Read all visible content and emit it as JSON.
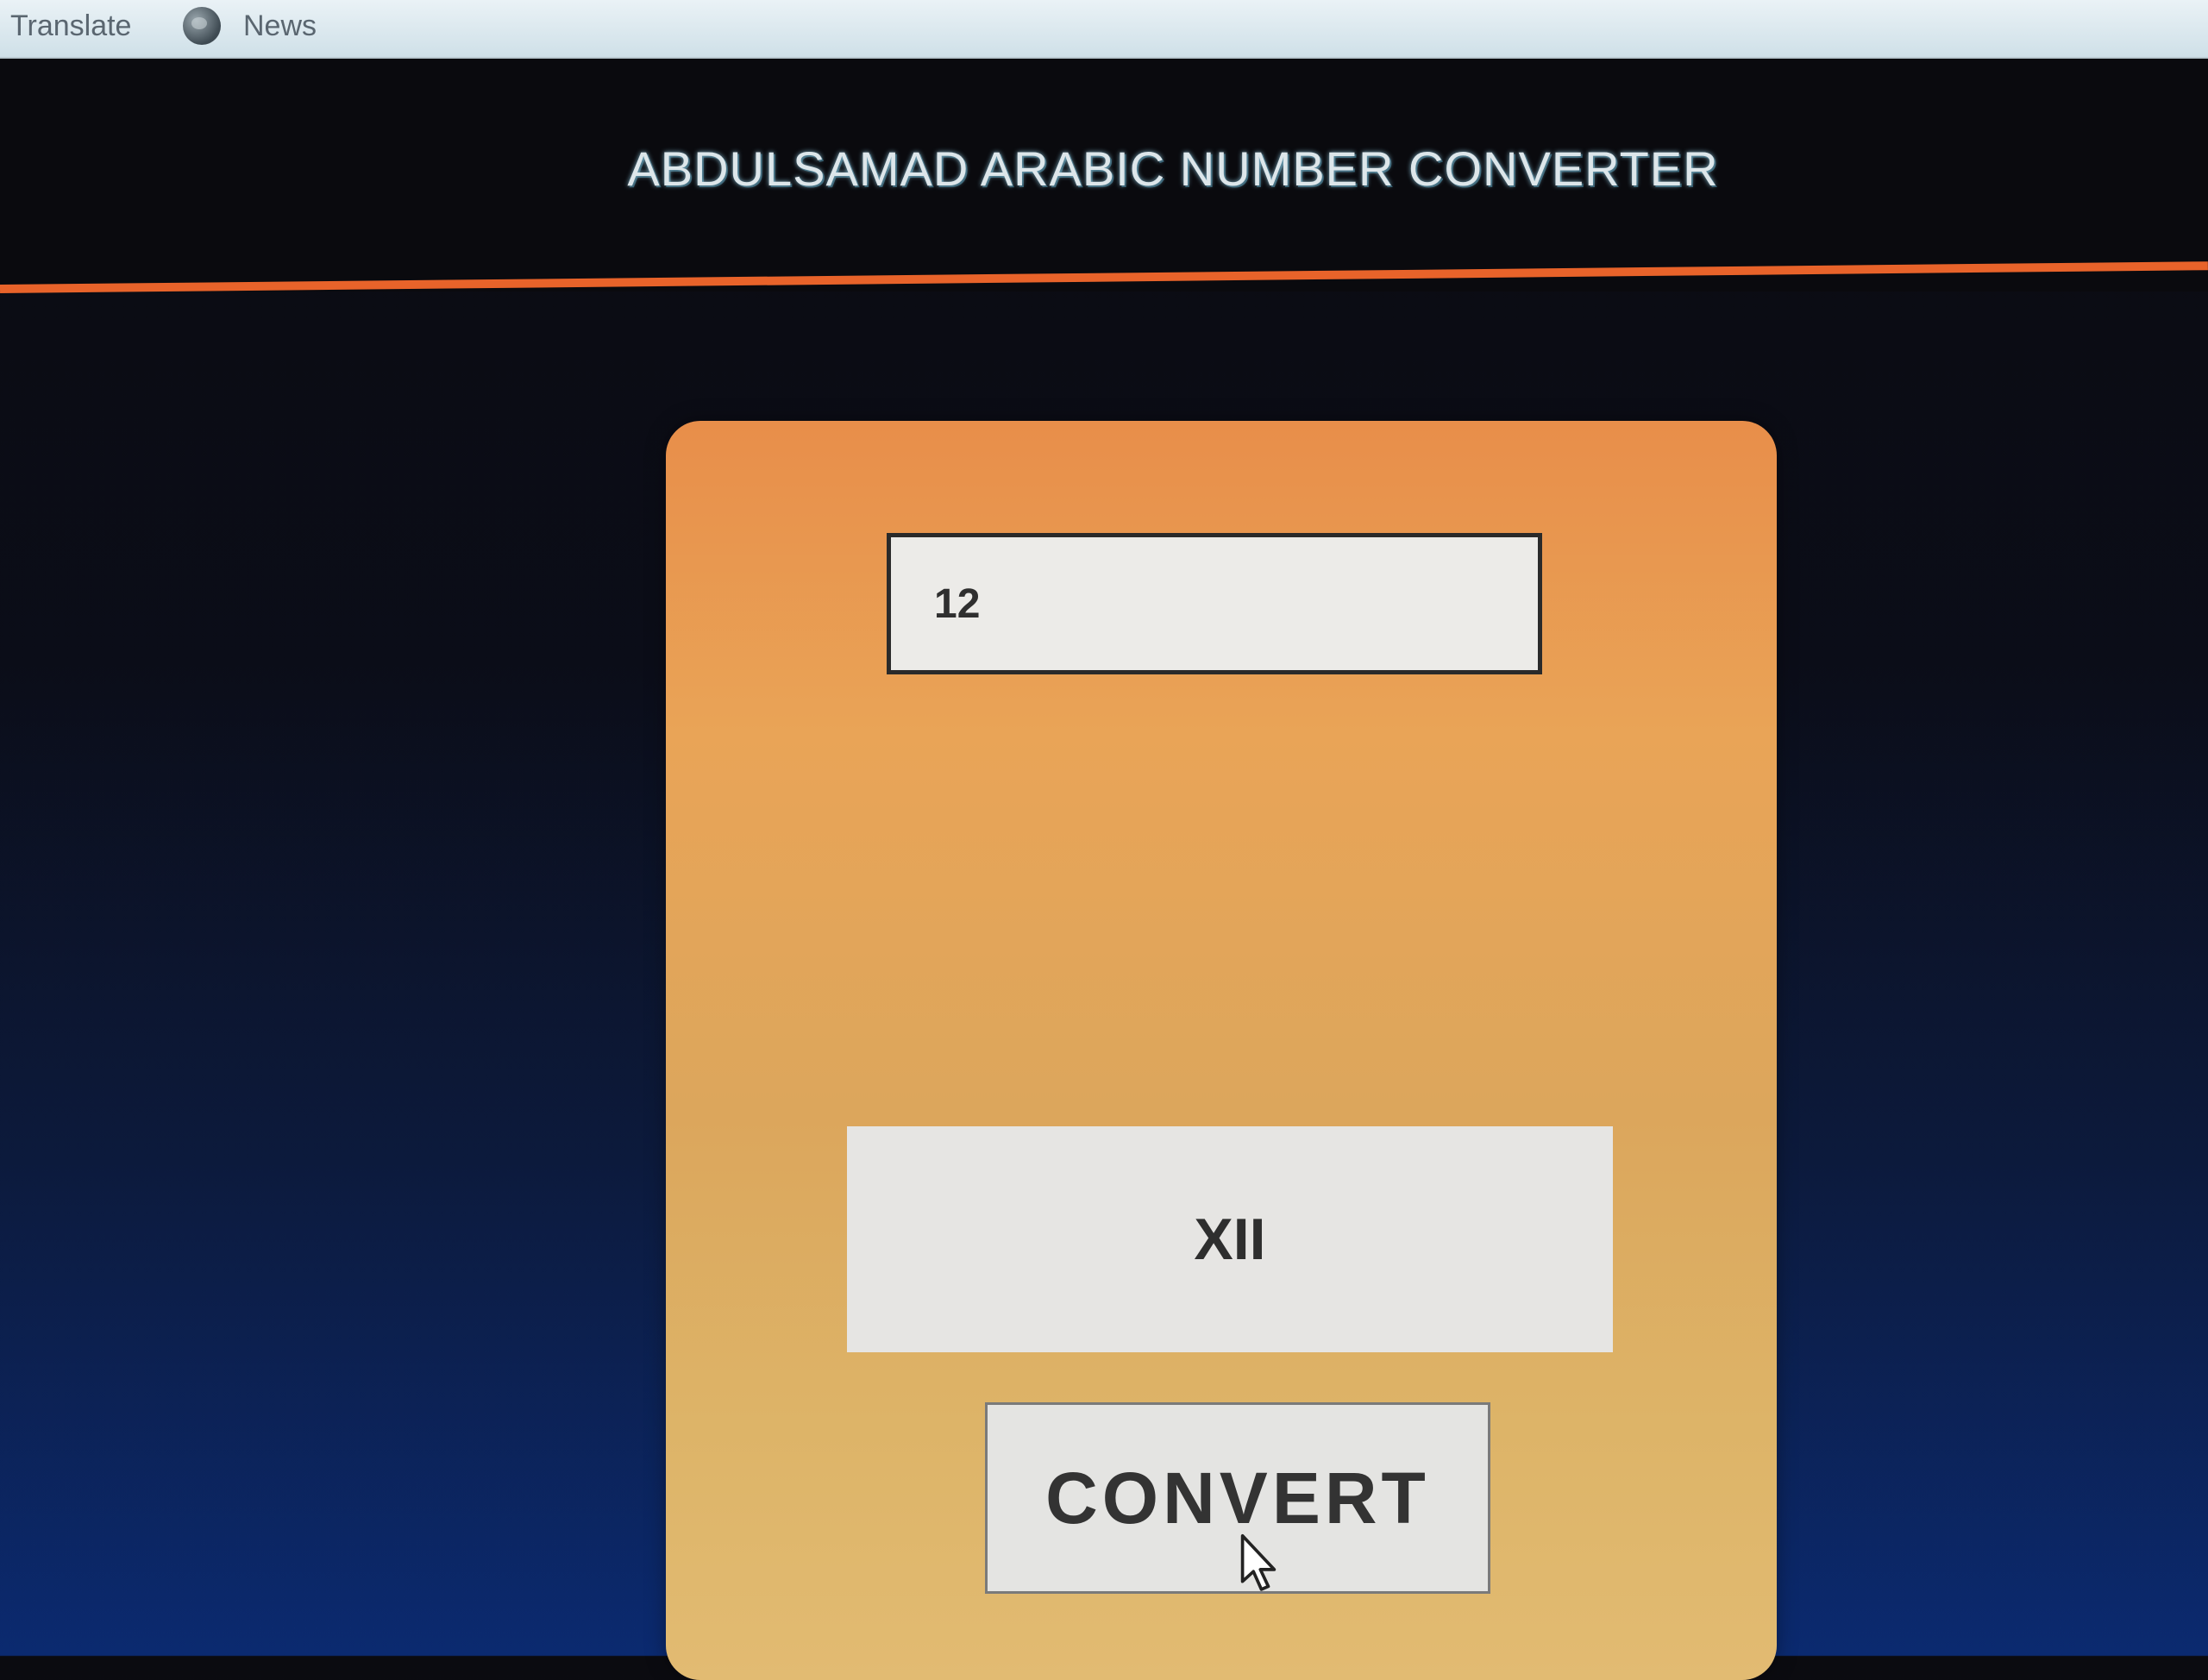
{
  "browser": {
    "bookmarks": [
      {
        "label": "Translate",
        "icon": "none"
      },
      {
        "label": "News",
        "icon": "globe-icon"
      }
    ]
  },
  "app": {
    "title": "ABDULSAMAD ARABIC NUMBER CONVERTER",
    "input_value": "12",
    "result": "XII",
    "convert_label": "CONVERT"
  },
  "colors": {
    "header_background": "#0a0a0e",
    "accent_rule": "#e8632a",
    "card_top": "#e88e4a",
    "card_bottom": "#e2bb72"
  }
}
